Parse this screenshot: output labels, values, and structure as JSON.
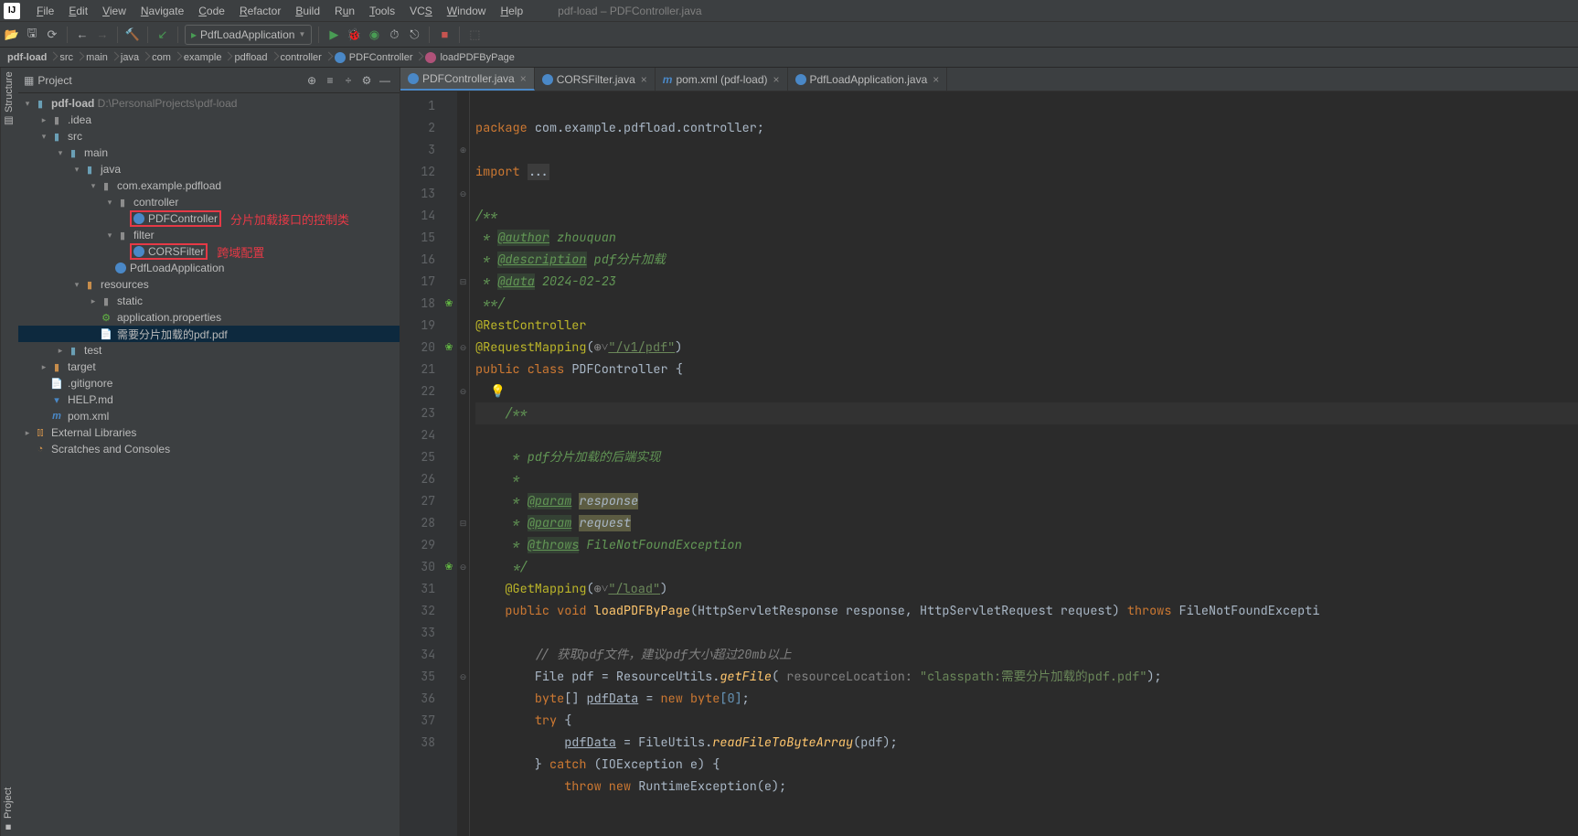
{
  "window": {
    "title": "pdf-load – PDFController.java"
  },
  "menu": [
    "File",
    "Edit",
    "View",
    "Navigate",
    "Code",
    "Refactor",
    "Build",
    "Run",
    "Tools",
    "VCS",
    "Window",
    "Help"
  ],
  "toolbar": {
    "run_config": "PdfLoadApplication"
  },
  "breadcrumb": [
    "pdf-load",
    "src",
    "main",
    "java",
    "com",
    "example",
    "pdfload",
    "controller",
    "PDFController",
    "loadPDFByPage"
  ],
  "project_panel": {
    "label": "Project"
  },
  "tree": {
    "root": {
      "name": "pdf-load",
      "path": "D:\\PersonalProjects\\pdf-load"
    },
    "idea": ".idea",
    "src": "src",
    "main": "main",
    "java": "java",
    "pkg": "com.example.pdfload",
    "controller": "controller",
    "pdfController": "PDFController",
    "filter": "filter",
    "corsFilter": "CORSFilter",
    "pdfLoadApp": "PdfLoadApplication",
    "resources": "resources",
    "static": "static",
    "appProps": "application.properties",
    "pdfFile": "需要分片加载的pdf.pdf",
    "test": "test",
    "target": "target",
    "gitignore": ".gitignore",
    "helpmd": "HELP.md",
    "pomxml": "pom.xml",
    "extLib": "External Libraries",
    "scratches": "Scratches and Consoles",
    "annot1": "分片加载接口的控制类",
    "annot2": "跨域配置"
  },
  "tabs": [
    {
      "label": "PDFController.java",
      "active": true,
      "icon": "c"
    },
    {
      "label": "CORSFilter.java",
      "active": false,
      "icon": "c"
    },
    {
      "label": "pom.xml (pdf-load)",
      "active": false,
      "icon": "m"
    },
    {
      "label": "PdfLoadApplication.java",
      "active": false,
      "icon": "c"
    }
  ],
  "code": {
    "lines": [
      "1",
      "2",
      "3",
      "12",
      "13",
      "14",
      "15",
      "16",
      "17",
      "18",
      "19",
      "20",
      "21",
      "22",
      "23",
      "24",
      "25",
      "26",
      "27",
      "28",
      "29",
      "30",
      "31",
      "32",
      "33",
      "34",
      "35",
      "36",
      "37",
      "38"
    ],
    "package": "package",
    "packageName": "com.example.pdfload.controller",
    "import": "import",
    "importRest": "...",
    "jdocStart": "/**",
    "star": " * ",
    "starEnd": " **/",
    "author": "@author",
    "authorVal": " zhouquan",
    "description": "@description",
    "descriptionVal": " pdf分片加载",
    "data": "@data",
    "dataVal": " 2024-02-23",
    "restController": "@RestController",
    "requestMapping": "@RequestMapping",
    "v1pdf": "\"/v1/pdf\"",
    "publicClass": "public class",
    "className": "PDFController",
    "jd2": "/**",
    "jd2desc": " * pdf分片加载的后端实现",
    "jd2blank": " *",
    "param": "@param",
    "paramResp": "response",
    "paramReq": "request",
    "throws": "@throws",
    "throwsExc": " FileNotFoundException",
    "jd2end": " */",
    "getMapping": "@GetMapping",
    "load": "\"/load\"",
    "publicVoid": "public void",
    "methodName": "loadPDFByPage",
    "methodParams": "(HttpServletResponse response, HttpServletRequest request)",
    "throwsKw": "throws",
    "throwsType": "FileNotFoundExcepti",
    "cmt1": "// 获取pdf文件，建议pdf大小超过20mb以上",
    "file": "File pdf = ResourceUtils",
    "getFile": "getFile",
    "resLocHint": "resourceLocation:",
    "resLoc": " \"classpath:需要分片加载的pdf.pdf\"",
    "byteDecl": "byte",
    "pdfData": "pdfData",
    "newbyte": " = ",
    "newKw": "new byte",
    "zero": "[0]",
    "try": "try",
    "pdfData2": "pdfData",
    "fileUtils": " = FileUtils.",
    "readFile": "readFileToByteArray",
    "readFileArg": "(pdf);",
    "catch": "catch",
    "catchArg": " (IOException e) {",
    "throwNew": "throw new",
    "runtime": " RuntimeException(e);"
  },
  "sidebar": {
    "project": "Project",
    "structure": "Structure"
  }
}
